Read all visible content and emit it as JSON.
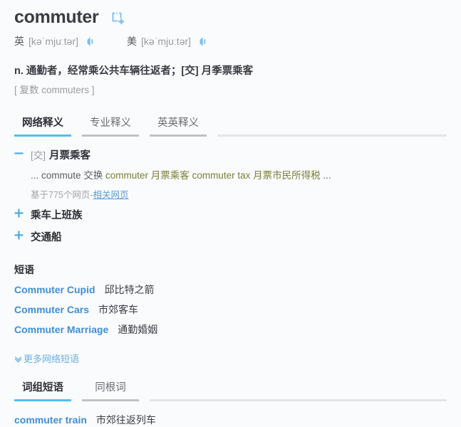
{
  "headword": {
    "word": "commuter",
    "add_icon": "add-to-wordbook-icon"
  },
  "phonetics": [
    {
      "lang": "英",
      "ipa": "[kəˈmjuːtər]",
      "audio_icon": "speaker-icon"
    },
    {
      "lang": "美",
      "ipa": "[kəˈmjuːtər]",
      "audio_icon": "speaker-icon"
    }
  ],
  "definition": {
    "main": "n. 通勤者，经常乘公共车辆往返者；[交] 月季票乘客",
    "plural": "[ 复数 commuters ]"
  },
  "tabs_top": [
    {
      "label": "网络释义",
      "active": true
    },
    {
      "label": "专业释义",
      "active": false
    },
    {
      "label": "英英释义",
      "active": false
    }
  ],
  "entries": [
    {
      "state": "expanded",
      "toggle_icon": "minus-icon",
      "tag": "[交]",
      "title": "月票乘客",
      "example_parts": [
        {
          "text": "... commute 交换 ",
          "highlight": false
        },
        {
          "text": "commuter 月票乘客",
          "highlight": true
        },
        {
          "text": " ",
          "highlight": false
        },
        {
          "text": "commuter tax 月票市民所得税",
          "highlight": true
        },
        {
          "text": " ...",
          "highlight": false
        }
      ],
      "source_text": "基于775个网页-",
      "source_link": "相关网页"
    },
    {
      "state": "collapsed",
      "toggle_icon": "plus-icon",
      "tag": "",
      "title": "乘车上班族"
    },
    {
      "state": "collapsed",
      "toggle_icon": "plus-icon",
      "tag": "",
      "title": "交通船"
    }
  ],
  "phrase_section": {
    "title": "短语",
    "items": [
      {
        "en": "Commuter Cupid",
        "cn": "邱比特之箭"
      },
      {
        "en": "Commuter Cars",
        "cn": "市郊客车"
      },
      {
        "en": "Commuter Marriage",
        "cn": "通勤婚姻"
      }
    ]
  },
  "more": {
    "icon": "chevron-down-icon",
    "label": "更多网络短语"
  },
  "tabs_bottom": [
    {
      "label": "词组短语",
      "active": true
    },
    {
      "label": "同根词",
      "active": false
    }
  ],
  "bottom_list": [
    {
      "en": "commuter train",
      "cn": "市郊往返列车"
    }
  ],
  "colors": {
    "accent": "#4fc0f0",
    "link": "#3e8fd4",
    "highlight": "#7d7d36",
    "background": "#fafbfd",
    "tab_inactive_rule": "#c0c1c3"
  }
}
